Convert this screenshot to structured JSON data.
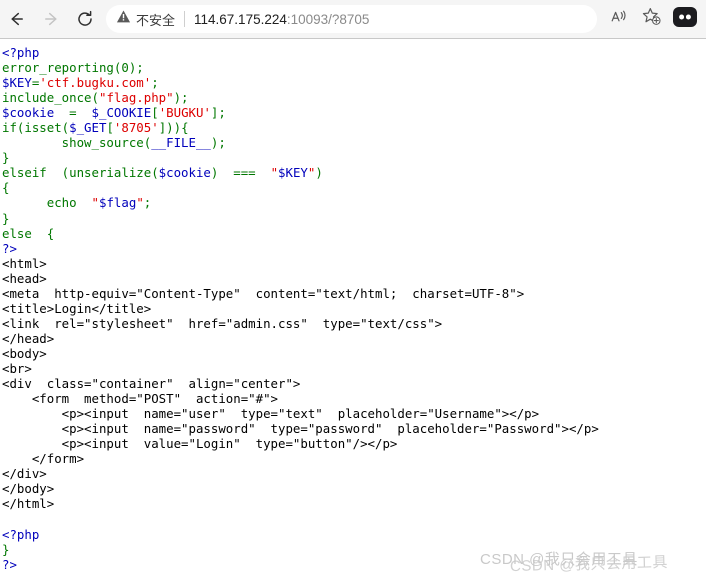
{
  "browser": {
    "back_icon": "arrow-left-icon",
    "forward_icon": "arrow-right-icon",
    "reload_icon": "reload-icon",
    "security": {
      "warning_icon": "warning-triangle-icon",
      "label": "不安全"
    },
    "url": {
      "host": "114.67.175.224",
      "rest": ":10093/?8705",
      "full": "114.67.175.224:10093/?8705"
    },
    "toolbar_right": {
      "read_aloud_icon": "read-aloud-icon",
      "add_favorite_icon": "add-to-favorites-star-icon",
      "profile_icon": "profile-avatar-icon"
    }
  },
  "page": {
    "source_lines": [
      {
        "t": "php_open",
        "text": "<?php"
      },
      {
        "t": "code",
        "text": "error_reporting(0);"
      },
      {
        "t": "code",
        "text": "$KEY='ctf.bugku.com';"
      },
      {
        "t": "code",
        "text": "include_once(\"flag.php\");"
      },
      {
        "t": "code",
        "text": "$cookie  =  $_COOKIE['BUGKU'];"
      },
      {
        "t": "code",
        "text": "if(isset($_GET['8705'])){"
      },
      {
        "t": "code",
        "text": "        show_source(__FILE__);"
      },
      {
        "t": "code",
        "text": "}"
      },
      {
        "t": "code",
        "text": "elseif  (unserialize($cookie)  ===  \"$KEY\")"
      },
      {
        "t": "code",
        "text": "{"
      },
      {
        "t": "code",
        "text": "      echo  \"$flag\";"
      },
      {
        "t": "code",
        "text": "}"
      },
      {
        "t": "code",
        "text": "else  {"
      },
      {
        "t": "php_close",
        "text": "?>"
      },
      {
        "t": "html",
        "text": "<html>"
      },
      {
        "t": "html",
        "text": "<head>"
      },
      {
        "t": "html",
        "text": "<meta  http-equiv=\"Content-Type\"  content=\"text/html;  charset=UTF-8\">"
      },
      {
        "t": "html",
        "text": "<title>Login</title>"
      },
      {
        "t": "html",
        "text": "<link  rel=\"stylesheet\"  href=\"admin.css\"  type=\"text/css\">"
      },
      {
        "t": "html",
        "text": "</head>"
      },
      {
        "t": "html",
        "text": "<body>"
      },
      {
        "t": "html",
        "text": "<br>"
      },
      {
        "t": "html",
        "text": "<div  class=\"container\"  align=\"center\">"
      },
      {
        "t": "html",
        "text": "    <form  method=\"POST\"  action=\"#\">"
      },
      {
        "t": "html",
        "text": "        <p><input  name=\"user\"  type=\"text\"  placeholder=\"Username\"></p>"
      },
      {
        "t": "html",
        "text": "        <p><input  name=\"password\"  type=\"password\"  placeholder=\"Password\"></p>"
      },
      {
        "t": "html",
        "text": "        <p><input  value=\"Login\"  type=\"button\"/></p>"
      },
      {
        "t": "html",
        "text": "    </form>"
      },
      {
        "t": "html",
        "text": "</div>"
      },
      {
        "t": "html",
        "text": "</body>"
      },
      {
        "t": "html",
        "text": "</html>"
      },
      {
        "t": "blank",
        "text": ""
      },
      {
        "t": "php_open",
        "text": "<?php"
      },
      {
        "t": "code",
        "text": "}"
      },
      {
        "t": "php_close",
        "text": "?>"
      }
    ],
    "watermark": {
      "line_1": "CSDN @我只会用工具",
      "line_2": "CSDN @我只会用工具"
    }
  },
  "colors": {
    "php_keyword": "#007700",
    "php_string": "#dd0000",
    "php_variable": "#0000bb",
    "html_text": "#000000",
    "chrome_bg": "#f5f5f5",
    "address_bg": "#ffffff",
    "watermark": "#c9c9c9"
  }
}
